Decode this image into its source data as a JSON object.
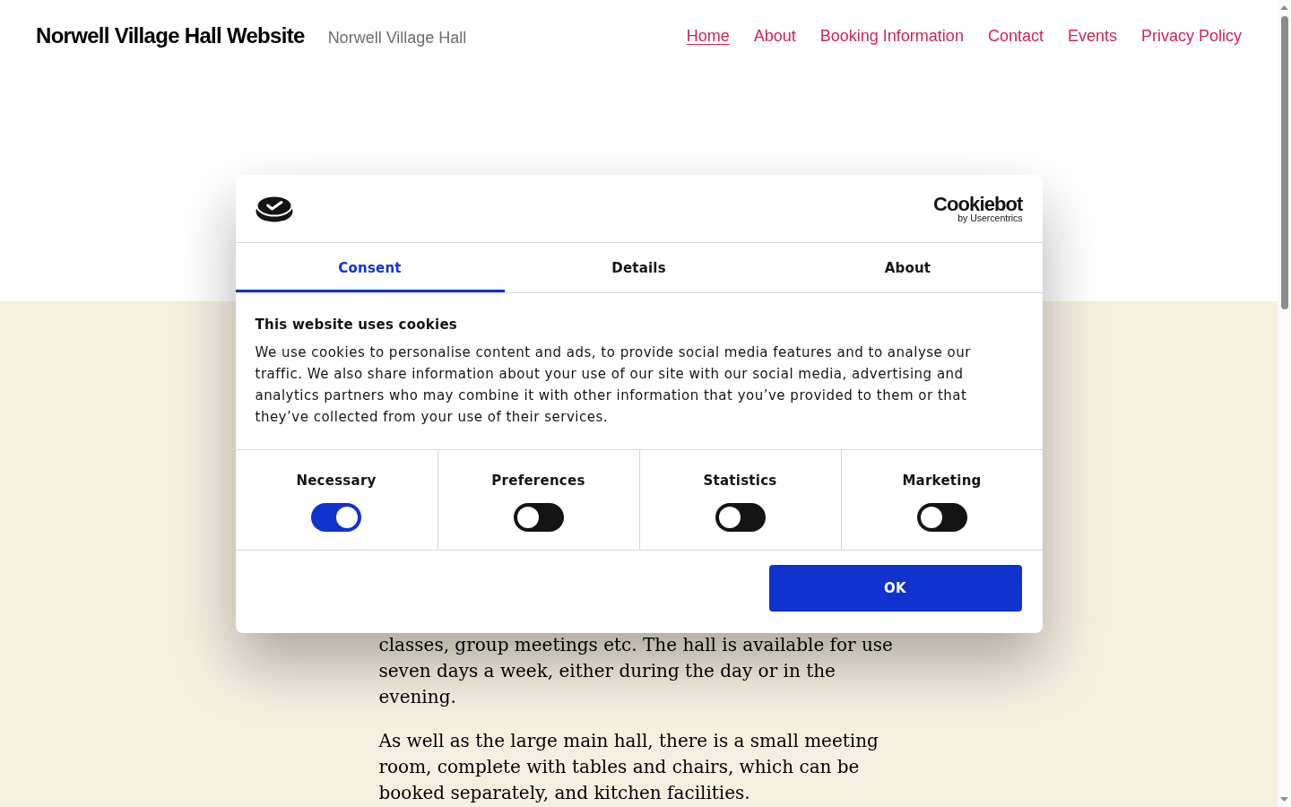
{
  "site_header": {
    "title": "Norwell Village Hall Website",
    "description": "Norwell Village Hall",
    "nav": [
      {
        "label": "Home",
        "selected": true
      },
      {
        "label": "About",
        "selected": false
      },
      {
        "label": "Booking Information",
        "selected": false
      },
      {
        "label": "Contact",
        "selected": false
      },
      {
        "label": "Events",
        "selected": false
      },
      {
        "label": "Privacy Policy",
        "selected": false
      }
    ]
  },
  "content": {
    "paragraphs": [
      "classes, group meetings etc. The hall is available for use seven days a week, either during the day or in the evening.",
      "As well as the large main hall, there is a small meeting room, complete with tables and chairs, which can be booked separately, and kitchen facilities."
    ]
  },
  "cookie_dialog": {
    "brand": {
      "name": "Cookiebot",
      "tagline": "by Usercentrics"
    },
    "tabs": [
      {
        "label": "Consent",
        "selected": true
      },
      {
        "label": "Details",
        "selected": false
      },
      {
        "label": "About",
        "selected": false
      }
    ],
    "heading": "This website uses cookies",
    "body": "We use cookies to personalise content and ads, to provide social media features and to analyse our traffic. We also share information about your use of our site with our social media, advertising and analytics partners who may combine it with other information that you’ve provided to them or that they’ve collected from your use of their services.",
    "toggles": [
      {
        "label": "Necessary",
        "on": true
      },
      {
        "label": "Preferences",
        "on": false
      },
      {
        "label": "Statistics",
        "on": false
      },
      {
        "label": "Marketing",
        "on": false
      }
    ],
    "button": "OK"
  }
}
